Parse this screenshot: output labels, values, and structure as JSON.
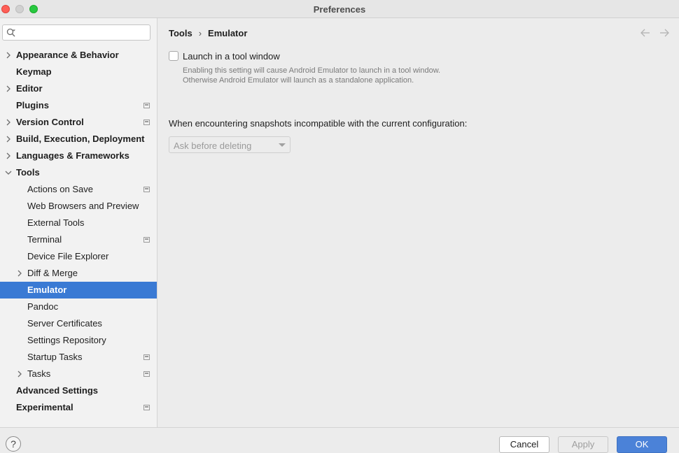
{
  "window": {
    "title": "Preferences"
  },
  "search": {
    "placeholder": "",
    "value": ""
  },
  "sidebar": {
    "items": [
      {
        "label": "Appearance & Behavior",
        "bold": true,
        "level": 0,
        "chevron": "right",
        "badge": false
      },
      {
        "label": "Keymap",
        "bold": true,
        "level": 0,
        "chevron": "none",
        "badge": false
      },
      {
        "label": "Editor",
        "bold": true,
        "level": 0,
        "chevron": "right",
        "badge": false
      },
      {
        "label": "Plugins",
        "bold": true,
        "level": 0,
        "chevron": "none",
        "badge": true
      },
      {
        "label": "Version Control",
        "bold": true,
        "level": 0,
        "chevron": "right",
        "badge": true
      },
      {
        "label": "Build, Execution, Deployment",
        "bold": true,
        "level": 0,
        "chevron": "right",
        "badge": false
      },
      {
        "label": "Languages & Frameworks",
        "bold": true,
        "level": 0,
        "chevron": "right",
        "badge": false
      },
      {
        "label": "Tools",
        "bold": true,
        "level": 0,
        "chevron": "down",
        "badge": false
      },
      {
        "label": "Actions on Save",
        "bold": false,
        "level": 1,
        "chevron": "none",
        "badge": true
      },
      {
        "label": "Web Browsers and Preview",
        "bold": false,
        "level": 1,
        "chevron": "none",
        "badge": false
      },
      {
        "label": "External Tools",
        "bold": false,
        "level": 1,
        "chevron": "none",
        "badge": false
      },
      {
        "label": "Terminal",
        "bold": false,
        "level": 1,
        "chevron": "none",
        "badge": true
      },
      {
        "label": "Device File Explorer",
        "bold": false,
        "level": 1,
        "chevron": "none",
        "badge": false
      },
      {
        "label": "Diff & Merge",
        "bold": false,
        "level": 1,
        "chevron": "right",
        "badge": false
      },
      {
        "label": "Emulator",
        "bold": true,
        "level": 1,
        "chevron": "none",
        "badge": false,
        "selected": true
      },
      {
        "label": "Pandoc",
        "bold": false,
        "level": 1,
        "chevron": "none",
        "badge": false
      },
      {
        "label": "Server Certificates",
        "bold": false,
        "level": 1,
        "chevron": "none",
        "badge": false
      },
      {
        "label": "Settings Repository",
        "bold": false,
        "level": 1,
        "chevron": "none",
        "badge": false
      },
      {
        "label": "Startup Tasks",
        "bold": false,
        "level": 1,
        "chevron": "none",
        "badge": true
      },
      {
        "label": "Tasks",
        "bold": false,
        "level": 1,
        "chevron": "right",
        "badge": true
      },
      {
        "label": "Advanced Settings",
        "bold": true,
        "level": 0,
        "chevron": "none",
        "badge": false
      },
      {
        "label": "Experimental",
        "bold": true,
        "level": 0,
        "chevron": "none",
        "badge": true
      }
    ]
  },
  "breadcrumb": {
    "parent": "Tools",
    "separator": "›",
    "current": "Emulator"
  },
  "settings": {
    "launch_checkbox_label": "Launch in a tool window",
    "launch_checked": false,
    "launch_description": "Enabling this setting will cause Android Emulator to launch in a tool window. Otherwise Android Emulator will launch as a standalone application.",
    "snapshots_label": "When encountering snapshots incompatible with the current configuration:",
    "snapshots_value": "Ask before deleting"
  },
  "footer": {
    "help_label": "?",
    "cancel_label": "Cancel",
    "apply_label": "Apply",
    "ok_label": "OK"
  },
  "colors": {
    "selection": "#3a7ad4",
    "ok_button": "#4b82d8",
    "close_light": "#fe5f57",
    "maximize_light": "#28c840"
  }
}
